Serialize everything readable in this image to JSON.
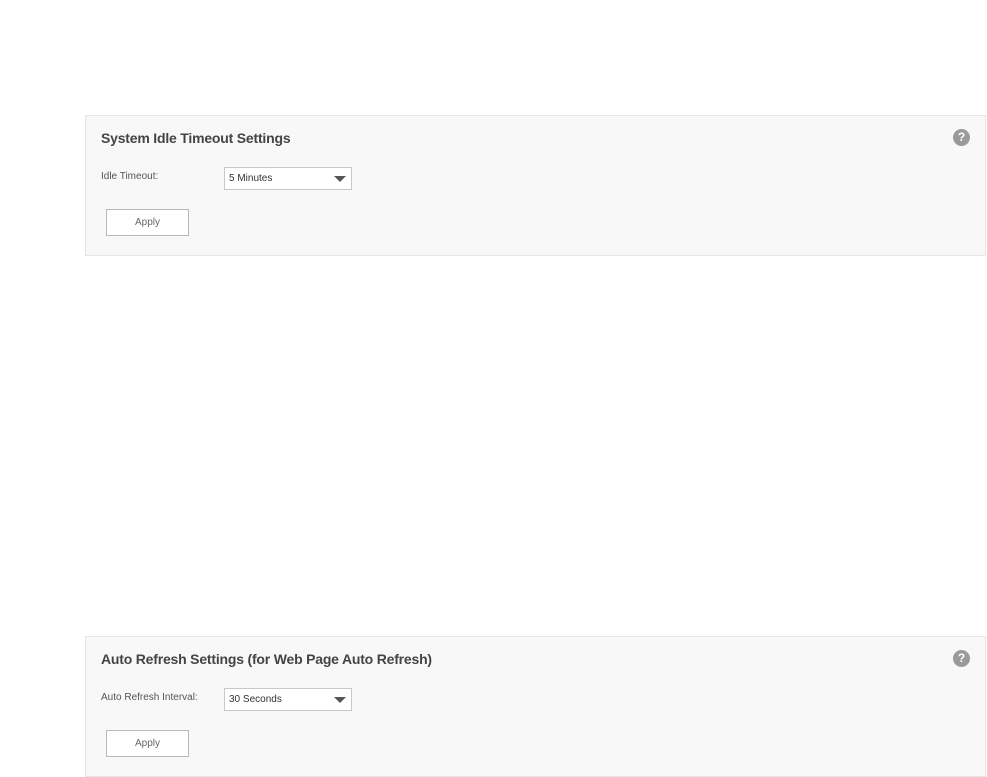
{
  "idle_timeout_section": {
    "title": "System Idle Timeout Settings",
    "help_glyph": "?",
    "help_icon": "question-circle-icon",
    "field_label": "Idle Timeout:",
    "selected_value": "5 Minutes",
    "apply_label": "Apply"
  },
  "auto_refresh_section": {
    "title": "Auto Refresh Settings (for Web Page Auto Refresh)",
    "help_glyph": "?",
    "help_icon": "question-circle-icon",
    "field_label": "Auto Refresh Interval:",
    "selected_value": "30 Seconds",
    "apply_label": "Apply"
  },
  "colors": {
    "panel_background": "#f8f8f8",
    "panel_border": "#e5e5e5",
    "help_icon": "#9a9a9a"
  }
}
